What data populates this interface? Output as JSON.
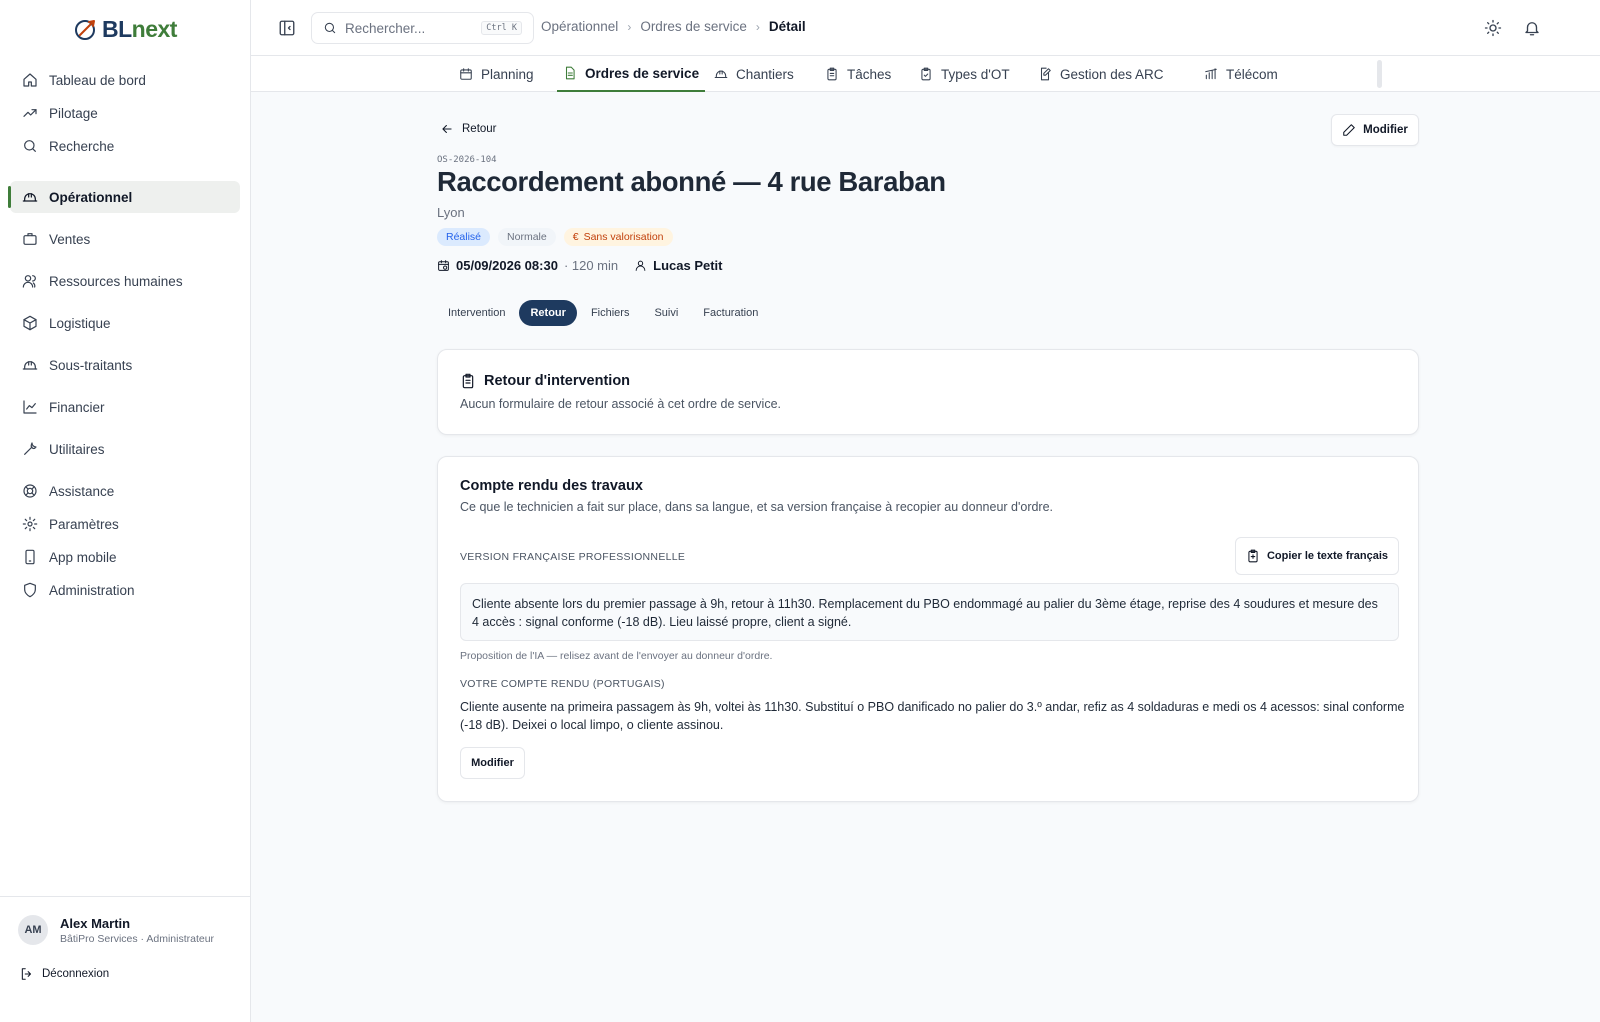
{
  "brand": {
    "name_part1": "BL",
    "name_part2": "next"
  },
  "sidebar": {
    "items": [
      {
        "label": "Tableau de bord",
        "icon": "home-icon"
      },
      {
        "label": "Pilotage",
        "icon": "trend-icon"
      },
      {
        "label": "Recherche",
        "icon": "search-icon"
      },
      {
        "label": "Opérationnel",
        "icon": "hardhat-icon",
        "active": true
      },
      {
        "label": "Ventes",
        "icon": "briefcase-icon"
      },
      {
        "label": "Ressources humaines",
        "icon": "users-icon"
      },
      {
        "label": "Logistique",
        "icon": "package-icon"
      },
      {
        "label": "Sous-traitants",
        "icon": "hardhat-icon"
      },
      {
        "label": "Financier",
        "icon": "chart-line-icon"
      },
      {
        "label": "Utilitaires",
        "icon": "wrench-icon"
      },
      {
        "label": "Assistance",
        "icon": "lifebuoy-icon"
      },
      {
        "label": "Paramètres",
        "icon": "gear-icon"
      },
      {
        "label": "App mobile",
        "icon": "phone-icon"
      },
      {
        "label": "Administration",
        "icon": "shield-icon"
      }
    ],
    "user": {
      "initials": "AM",
      "name": "Alex Martin",
      "role": "BâtiPro Services · Administrateur"
    },
    "logout_label": "Déconnexion"
  },
  "topbar": {
    "search_placeholder": "Rechercher...",
    "search_shortcut": "Ctrl K",
    "breadcrumb": [
      "Opérationnel",
      "Ordres de service",
      "Détail"
    ]
  },
  "module_tabs": [
    {
      "label": "Planning",
      "icon": "calendar-icon"
    },
    {
      "label": "Ordres de service",
      "icon": "document-icon",
      "active": true
    },
    {
      "label": "Chantiers",
      "icon": "hardhat-icon"
    },
    {
      "label": "Tâches",
      "icon": "clipboard-icon"
    },
    {
      "label": "Types d'OT",
      "icon": "clipboard-check-icon"
    },
    {
      "label": "Gestion des ARC",
      "icon": "file-edit-icon"
    },
    {
      "label": "Télécom",
      "icon": "signal-icon"
    }
  ],
  "detail": {
    "back_label": "Retour",
    "edit_label": "Modifier",
    "os_id": "OS-2026-104",
    "title": "Raccordement abonné — 4 rue Baraban",
    "city": "Lyon",
    "badges": {
      "status": "Réalisé",
      "priority": "Normale",
      "valuation": "Sans valorisation",
      "valuation_symbol": "€"
    },
    "datetime": "05/09/2026 08:30",
    "duration": "· 120 min",
    "technician": "Lucas Petit",
    "sub_tabs": [
      "Intervention",
      "Retour",
      "Fichiers",
      "Suivi",
      "Facturation"
    ],
    "active_sub_tab": "Retour"
  },
  "retour_card": {
    "title": "Retour d'intervention",
    "subtitle": "Aucun formulaire de retour associé à cet ordre de service."
  },
  "report_card": {
    "title": "Compte rendu des travaux",
    "subtitle": "Ce que le technicien a fait sur place, dans sa langue, et sa version française à recopier au donneur d'ordre.",
    "fr_label": "VERSION FRANÇAISE PROFESSIONNELLE",
    "copy_label": "Copier le texte français",
    "fr_text": "Cliente absente lors du premier passage à 9h, retour à 11h30. Remplacement du PBO endommagé au palier du 3ème étage, reprise des 4 soudures et mesure des 4 accès : signal conforme (-18 dB). Lieu laissé propre, client a signé.",
    "ai_note": "Proposition de l'IA — relisez avant de l'envoyer au donneur d'ordre.",
    "pt_label": "VOTRE COMPTE RENDU (PORTUGAIS)",
    "pt_text": "Cliente ausente na primeira passagem às 9h, voltei às 11h30. Substituí o PBO danificado no palier do 3.º andar, refiz as 4 soldaduras e medi os 4 acessos: sinal conforme (-18 dB). Deixei o local limpo, o cliente assinou.",
    "edit_label": "Modifier"
  }
}
